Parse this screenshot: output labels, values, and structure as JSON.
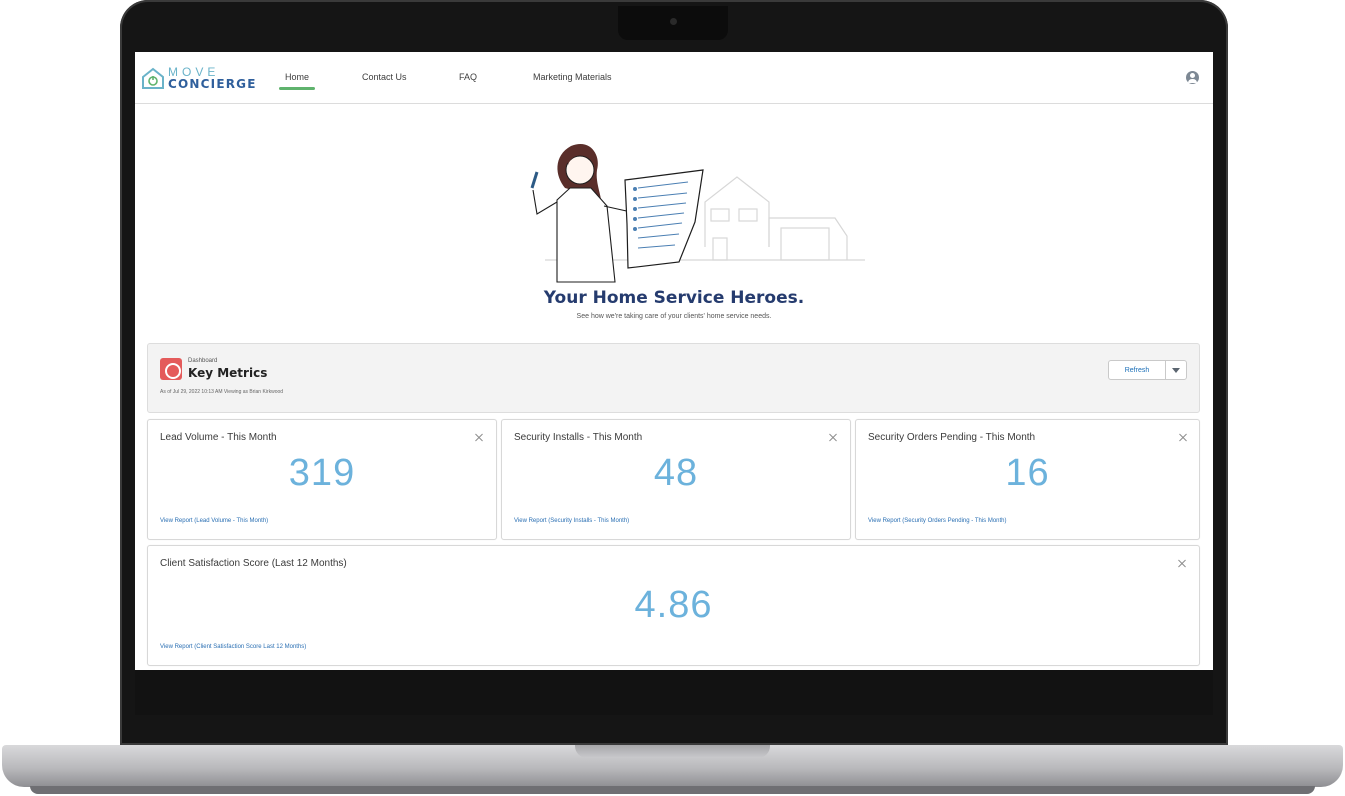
{
  "nav": {
    "logo_top": "MOVE",
    "logo_bottom": "CONCIERGE",
    "tabs": [
      {
        "label": "Home",
        "active": true
      },
      {
        "label": "Contact Us",
        "active": false
      },
      {
        "label": "FAQ",
        "active": false
      },
      {
        "label": "Marketing Materials",
        "active": false
      }
    ]
  },
  "hero": {
    "title": "Your Home Service Heroes.",
    "subtitle": "See how we're taking care of your clients' home service needs."
  },
  "dashboard": {
    "kicker": "Dashboard",
    "title": "Key Metrics",
    "as_of": "As of Jul 29, 2022 10:13 AM Viewing as Brian Kirkwood",
    "refresh_label": "Refresh"
  },
  "metrics": [
    {
      "title": "Lead Volume - This Month",
      "value": "319",
      "link": "View Report (Lead Volume - This Month)"
    },
    {
      "title": "Security Installs - This Month",
      "value": "48",
      "link": "View Report (Security Installs - This Month)"
    },
    {
      "title": "Security Orders Pending - This Month",
      "value": "16",
      "link": "View Report (Security Orders Pending - This Month)"
    },
    {
      "title": "Client Satisfaction Score (Last 12 Months)",
      "value": "4.86",
      "link": "View Report (Client Satisfaction Score Last 12 Months)"
    }
  ],
  "colors": {
    "accent_blue": "#6cb2dc",
    "active_tab": "#5fb36d",
    "brand_navy": "#253b6e",
    "dashboard_icon": "#e45b5b"
  }
}
